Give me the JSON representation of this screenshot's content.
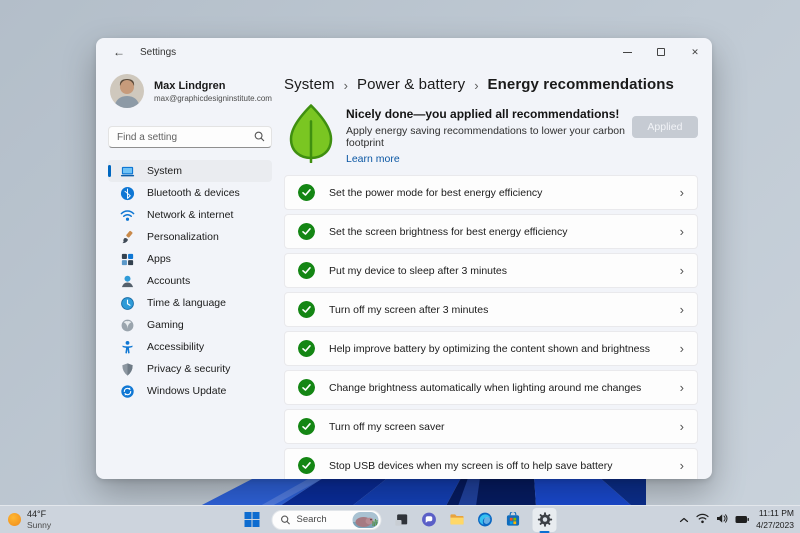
{
  "colors": {
    "accent": "#0067c0",
    "success_green": "#148614",
    "link_blue": "#0b57a4",
    "leaf_green": "#7ac622",
    "leaf_outline": "#3f8f10",
    "applied_button_bg": "#c6cbd3"
  },
  "window": {
    "title": "Settings",
    "icons": {
      "back_glyph": "←",
      "close_glyph": "✕"
    }
  },
  "profile": {
    "name": "Max Lindgren",
    "email": "max@graphicdesigninstitute.com"
  },
  "search": {
    "placeholder": "Find a setting"
  },
  "sidebar": {
    "items": [
      {
        "label": "System",
        "icon": "system-icon",
        "selected": true
      },
      {
        "label": "Bluetooth & devices",
        "icon": "bluetooth-icon",
        "selected": false
      },
      {
        "label": "Network & internet",
        "icon": "network-icon",
        "selected": false
      },
      {
        "label": "Personalization",
        "icon": "personalization-icon",
        "selected": false
      },
      {
        "label": "Apps",
        "icon": "apps-icon",
        "selected": false
      },
      {
        "label": "Accounts",
        "icon": "accounts-icon",
        "selected": false
      },
      {
        "label": "Time & language",
        "icon": "time-language-icon",
        "selected": false
      },
      {
        "label": "Gaming",
        "icon": "gaming-icon",
        "selected": false
      },
      {
        "label": "Accessibility",
        "icon": "accessibility-icon",
        "selected": false
      },
      {
        "label": "Privacy & security",
        "icon": "privacy-security-icon",
        "selected": false
      },
      {
        "label": "Windows Update",
        "icon": "windows-update-icon",
        "selected": false
      }
    ]
  },
  "breadcrumb": {
    "separator": "›",
    "items": [
      "System",
      "Power & battery",
      "Energy recommendations"
    ]
  },
  "hero": {
    "title": "Nicely done—you applied all recommendations!",
    "subtitle": "Apply energy saving recommendations to lower your carbon footprint",
    "link_label": "Learn more",
    "button_label": "Applied"
  },
  "icons": {
    "chevron_right_glyph": "›"
  },
  "recommendations": [
    "Set the power mode for best energy efficiency",
    "Set the screen brightness for best energy efficiency",
    "Put my device to sleep after 3 minutes",
    "Turn off my screen after 3 minutes",
    "Help improve battery by optimizing the content shown and brightness",
    "Change brightness automatically when lighting around me changes",
    "Turn off my screen saver",
    "Stop USB devices when my screen is off to help save battery"
  ],
  "taskbar": {
    "weather": {
      "temp": "44°F",
      "condition": "Sunny"
    },
    "search_label": "Search",
    "clock": {
      "time": "11:11 PM",
      "date": "4/27/2023"
    }
  }
}
